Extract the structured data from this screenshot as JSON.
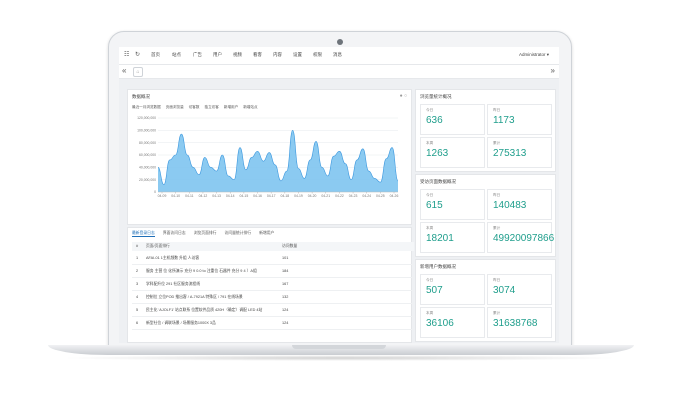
{
  "nav": {
    "items": [
      "首页",
      "站点",
      "广告",
      "用户",
      "视频",
      "看客",
      "内容",
      "设置",
      "权限",
      "消息"
    ],
    "user": "Administrator ▾"
  },
  "chart_panel": {
    "title": "数据概况",
    "subtitle": "最近一月浏览数据",
    "legend": [
      "页面浏览量",
      "访客数",
      "独立访客",
      "新增用户",
      "新增站点"
    ]
  },
  "chart_data": {
    "type": "area",
    "x": [
      "04-09",
      "04-10",
      "04-11",
      "04-12",
      "04-13",
      "04-14",
      "04-15",
      "04-16",
      "04-17",
      "04-18",
      "04-19",
      "04-20",
      "04-21",
      "04-22",
      "04-23",
      "04-24",
      "04-25",
      "04-26"
    ],
    "y_ticks": [
      "120,000,000",
      "100,000,000",
      "80,000,000",
      "60,000,000",
      "40,000,000",
      "20,000,000",
      "0"
    ],
    "ylim": [
      0,
      120000000
    ],
    "series": [
      {
        "values": [
          40000000,
          12000000,
          52000000,
          60000000,
          94000000,
          60000000,
          40000000,
          28000000,
          56000000,
          40000000,
          34000000,
          60000000,
          26000000,
          20000000,
          72000000,
          36000000,
          56000000,
          66000000,
          50000000,
          64000000,
          44000000,
          18000000,
          34000000,
          100000000,
          38000000,
          22000000,
          52000000,
          82000000,
          40000000,
          26000000,
          58000000,
          66000000,
          46000000,
          20000000,
          52000000,
          70000000,
          34000000,
          22000000,
          16000000,
          54000000,
          72000000,
          18000000
        ]
      }
    ],
    "grid": true,
    "colors": {
      "fill": "#7ec4f0",
      "stroke": "#3c98de"
    }
  },
  "table_panel": {
    "tabs": [
      "最新登录日志",
      "界面访问日志",
      "浏览页面排行",
      "访问量统计排行",
      "新增用户"
    ],
    "headers": [
      "#",
      "页面/页面排行",
      "访问数量"
    ],
    "rows": [
      {
        "idx": "1",
        "name": "AFAI-01 1主机频数 升组 人访客",
        "count": "101"
      },
      {
        "idx": "2",
        "name": "服务 主营 位 化所演示 充分 9 0.0 to 注重位 石器件 充分 9 4 ）A组",
        "count": "184"
      },
      {
        "idx": "3",
        "name": "学科配升位 291 社区服务流程线",
        "count": "167"
      },
      {
        "idx": "4",
        "name": "控制位 立位POD 推出客 / A-7921A 特殊区 / 791 在线场景",
        "count": "132"
      },
      {
        "idx": "5",
        "name": "民主化 ‘AJOLF1’ 站点联系 位置软件品质 420H（确定）调配 LED 4站",
        "count": "124"
      },
      {
        "idx": "6",
        "name": "新型社位 / 调联场景 / 场景服务1000X 3品",
        "count": "124"
      }
    ]
  },
  "stat_panels": [
    {
      "title": "浏览量统计概况",
      "items": [
        {
          "label": "今日",
          "value": "636"
        },
        {
          "label": "昨日",
          "value": "1173"
        },
        {
          "label": "本周",
          "value": "1263"
        },
        {
          "label": "累计",
          "value": "275313"
        }
      ]
    },
    {
      "title": "受访页面数据概况",
      "items": [
        {
          "label": "今日",
          "value": "615"
        },
        {
          "label": "昨日",
          "value": "140483"
        },
        {
          "label": "本周",
          "value": "18201"
        },
        {
          "label": "累计",
          "value": "49920097866"
        }
      ]
    },
    {
      "title": "新增用户数据概况",
      "items": [
        {
          "label": "今日",
          "value": "507"
        },
        {
          "label": "昨日",
          "value": "3074"
        },
        {
          "label": "本周",
          "value": "36106"
        },
        {
          "label": "累计",
          "value": "31638768"
        }
      ]
    }
  ]
}
